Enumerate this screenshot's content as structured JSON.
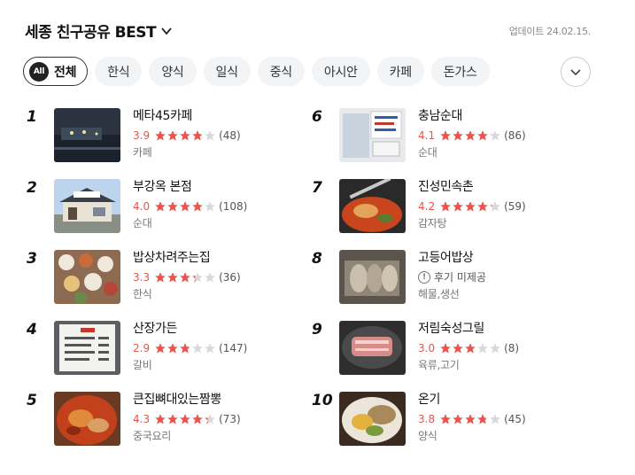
{
  "header": {
    "title": "세종 친구공유 BEST",
    "updated": "업데이트 24.02.15."
  },
  "tabs": [
    {
      "label": "전체",
      "badge": "All",
      "active": true
    },
    {
      "label": "한식"
    },
    {
      "label": "양식"
    },
    {
      "label": "일식"
    },
    {
      "label": "중식"
    },
    {
      "label": "아시안"
    },
    {
      "label": "카페"
    },
    {
      "label": "돈가스"
    }
  ],
  "colors": {
    "star_filled": "#e8544e",
    "star_empty": "#d9d9d9",
    "score": "#e8544e"
  },
  "left_items": [
    {
      "rank": "1",
      "name": "메타45카페",
      "score": "3.9",
      "stars": 3.9,
      "count": "(48)",
      "category": "카페",
      "thumb": "cafe-night-photo"
    },
    {
      "rank": "2",
      "name": "부강옥 본점",
      "score": "4.0",
      "stars": 4.0,
      "count": "(108)",
      "category": "순대",
      "thumb": "restaurant-building-photo"
    },
    {
      "rank": "3",
      "name": "밥상차려주는집",
      "score": "3.3",
      "stars": 3.3,
      "count": "(36)",
      "category": "한식",
      "thumb": "korean-table-photo"
    },
    {
      "rank": "4",
      "name": "산장가든",
      "score": "2.9",
      "stars": 2.9,
      "count": "(147)",
      "category": "갈비",
      "thumb": "menu-board-photo"
    },
    {
      "rank": "5",
      "name": "큰집뼈대있는짬뽕",
      "score": "4.3",
      "stars": 4.3,
      "count": "(73)",
      "category": "중국요리",
      "thumb": "jjamppong-photo"
    }
  ],
  "right_items": [
    {
      "rank": "6",
      "name": "충남순대",
      "score": "4.1",
      "stars": 4.1,
      "count": "(86)",
      "category": "순대",
      "thumb": "storefront-sign-photo"
    },
    {
      "rank": "7",
      "name": "진성민속촌",
      "score": "4.2",
      "stars": 4.2,
      "count": "(59)",
      "category": "감자탕",
      "thumb": "gamjatang-photo"
    },
    {
      "rank": "8",
      "name": "고등어밥상",
      "no_review": "후기 미제공",
      "category": "해물,생선",
      "thumb": "grilled-fish-photo"
    },
    {
      "rank": "9",
      "name": "저림숙성그릴",
      "score": "3.0",
      "stars": 3.0,
      "count": "(8)",
      "category": "육류,고기",
      "thumb": "grilled-meat-photo"
    },
    {
      "rank": "10",
      "name": "온기",
      "score": "3.8",
      "stars": 3.8,
      "count": "(45)",
      "category": "양식",
      "thumb": "brunch-plate-photo"
    }
  ]
}
